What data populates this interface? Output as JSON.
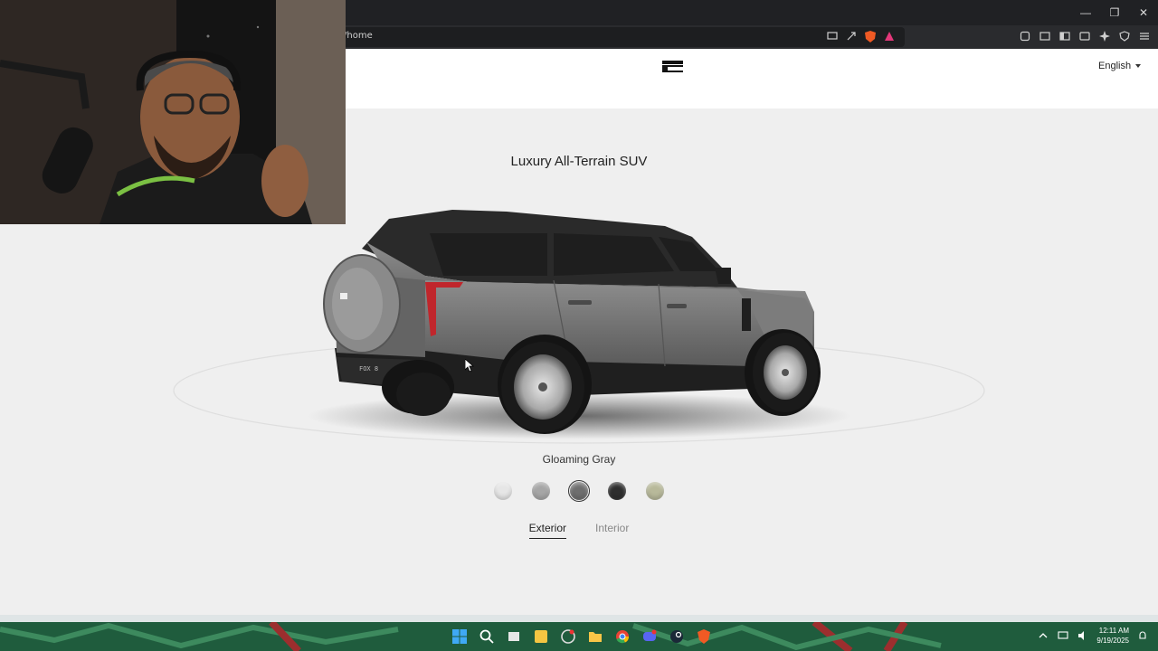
{
  "browser": {
    "url_text": "/home",
    "window_controls": [
      "minimize",
      "restore",
      "close"
    ]
  },
  "site": {
    "logo_icon": "brand-logo-icon",
    "language": "English"
  },
  "configurator": {
    "model_title": "Luxury All-Terrain SUV",
    "selected_color_name": "Gloaming Gray",
    "plate_text": "FOX 8",
    "swatches": [
      {
        "name": "white-swatch",
        "color": "#e6e6e6",
        "selected": false
      },
      {
        "name": "light-gray-swatch",
        "color": "#a6a6a6",
        "selected": false
      },
      {
        "name": "gloaming-gray-swatch",
        "color": "#6e6e6e",
        "selected": true
      },
      {
        "name": "black-swatch",
        "color": "#2e2e2e",
        "selected": false
      },
      {
        "name": "sage-swatch",
        "color": "#b8b99a",
        "selected": false
      }
    ],
    "tabs": [
      {
        "label": "Exterior",
        "active": true
      },
      {
        "label": "Interior",
        "active": false
      }
    ]
  },
  "taskbar": {
    "time": "12:11 AM",
    "date": "9/19/2025"
  }
}
